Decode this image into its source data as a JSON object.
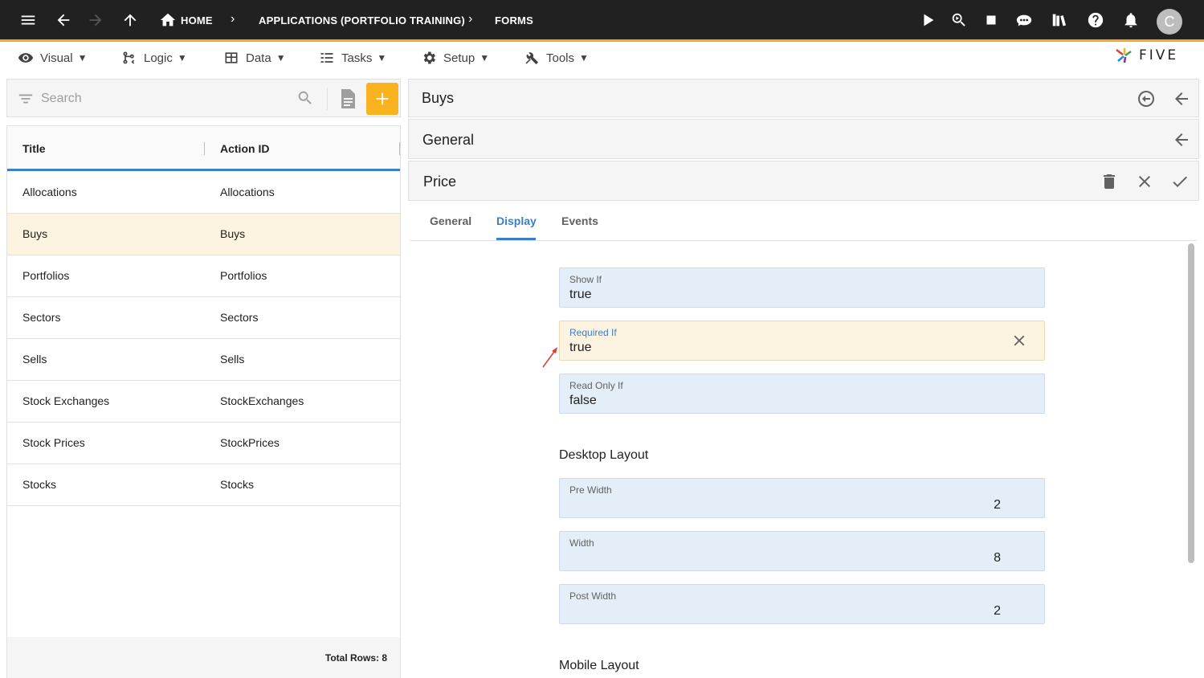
{
  "topbar": {
    "breadcrumbs": [
      "HOME",
      "APPLICATIONS (PORTFOLIO TRAINING)",
      "FORMS"
    ],
    "avatar_initial": "C"
  },
  "menu": {
    "items": [
      {
        "label": "Visual",
        "icon": "eye-icon"
      },
      {
        "label": "Logic",
        "icon": "logic-icon"
      },
      {
        "label": "Data",
        "icon": "table-icon"
      },
      {
        "label": "Tasks",
        "icon": "tasks-icon"
      },
      {
        "label": "Setup",
        "icon": "gear-icon"
      },
      {
        "label": "Tools",
        "icon": "tools-icon"
      }
    ],
    "logo_text": "FIVE"
  },
  "search": {
    "placeholder": "Search"
  },
  "list": {
    "columns": [
      "Title",
      "Action ID"
    ],
    "rows": [
      {
        "title": "Allocations",
        "action_id": "Allocations"
      },
      {
        "title": "Buys",
        "action_id": "Buys"
      },
      {
        "title": "Portfolios",
        "action_id": "Portfolios"
      },
      {
        "title": "Sectors",
        "action_id": "Sectors"
      },
      {
        "title": "Sells",
        "action_id": "Sells"
      },
      {
        "title": "Stock Exchanges",
        "action_id": "StockExchanges"
      },
      {
        "title": "Stock Prices",
        "action_id": "StockPrices"
      },
      {
        "title": "Stocks",
        "action_id": "Stocks"
      }
    ],
    "total_rows": "Total Rows: 8"
  },
  "panels": {
    "form_title": "Buys",
    "page_title": "General",
    "field_title": "Price"
  },
  "tabs": [
    "General",
    "Display",
    "Events"
  ],
  "active_tab": "Display",
  "fields": {
    "show_if": {
      "label": "Show If",
      "value": "true"
    },
    "required_if": {
      "label": "Required If",
      "value": "true"
    },
    "read_only_if": {
      "label": "Read Only If",
      "value": "false"
    },
    "desktop_layout_title": "Desktop Layout",
    "pre_width": {
      "label": "Pre Width",
      "value": "2"
    },
    "width": {
      "label": "Width",
      "value": "8"
    },
    "post_width": {
      "label": "Post Width",
      "value": "2"
    },
    "mobile_layout_title": "Mobile Layout"
  },
  "colors": {
    "accent": "#f9b31e",
    "primary": "#3a7fc9",
    "topbar": "#212121",
    "selected_row": "#fdf3e1",
    "field_bg": "#e3eef9",
    "annotation_arrow": "#e53935"
  }
}
